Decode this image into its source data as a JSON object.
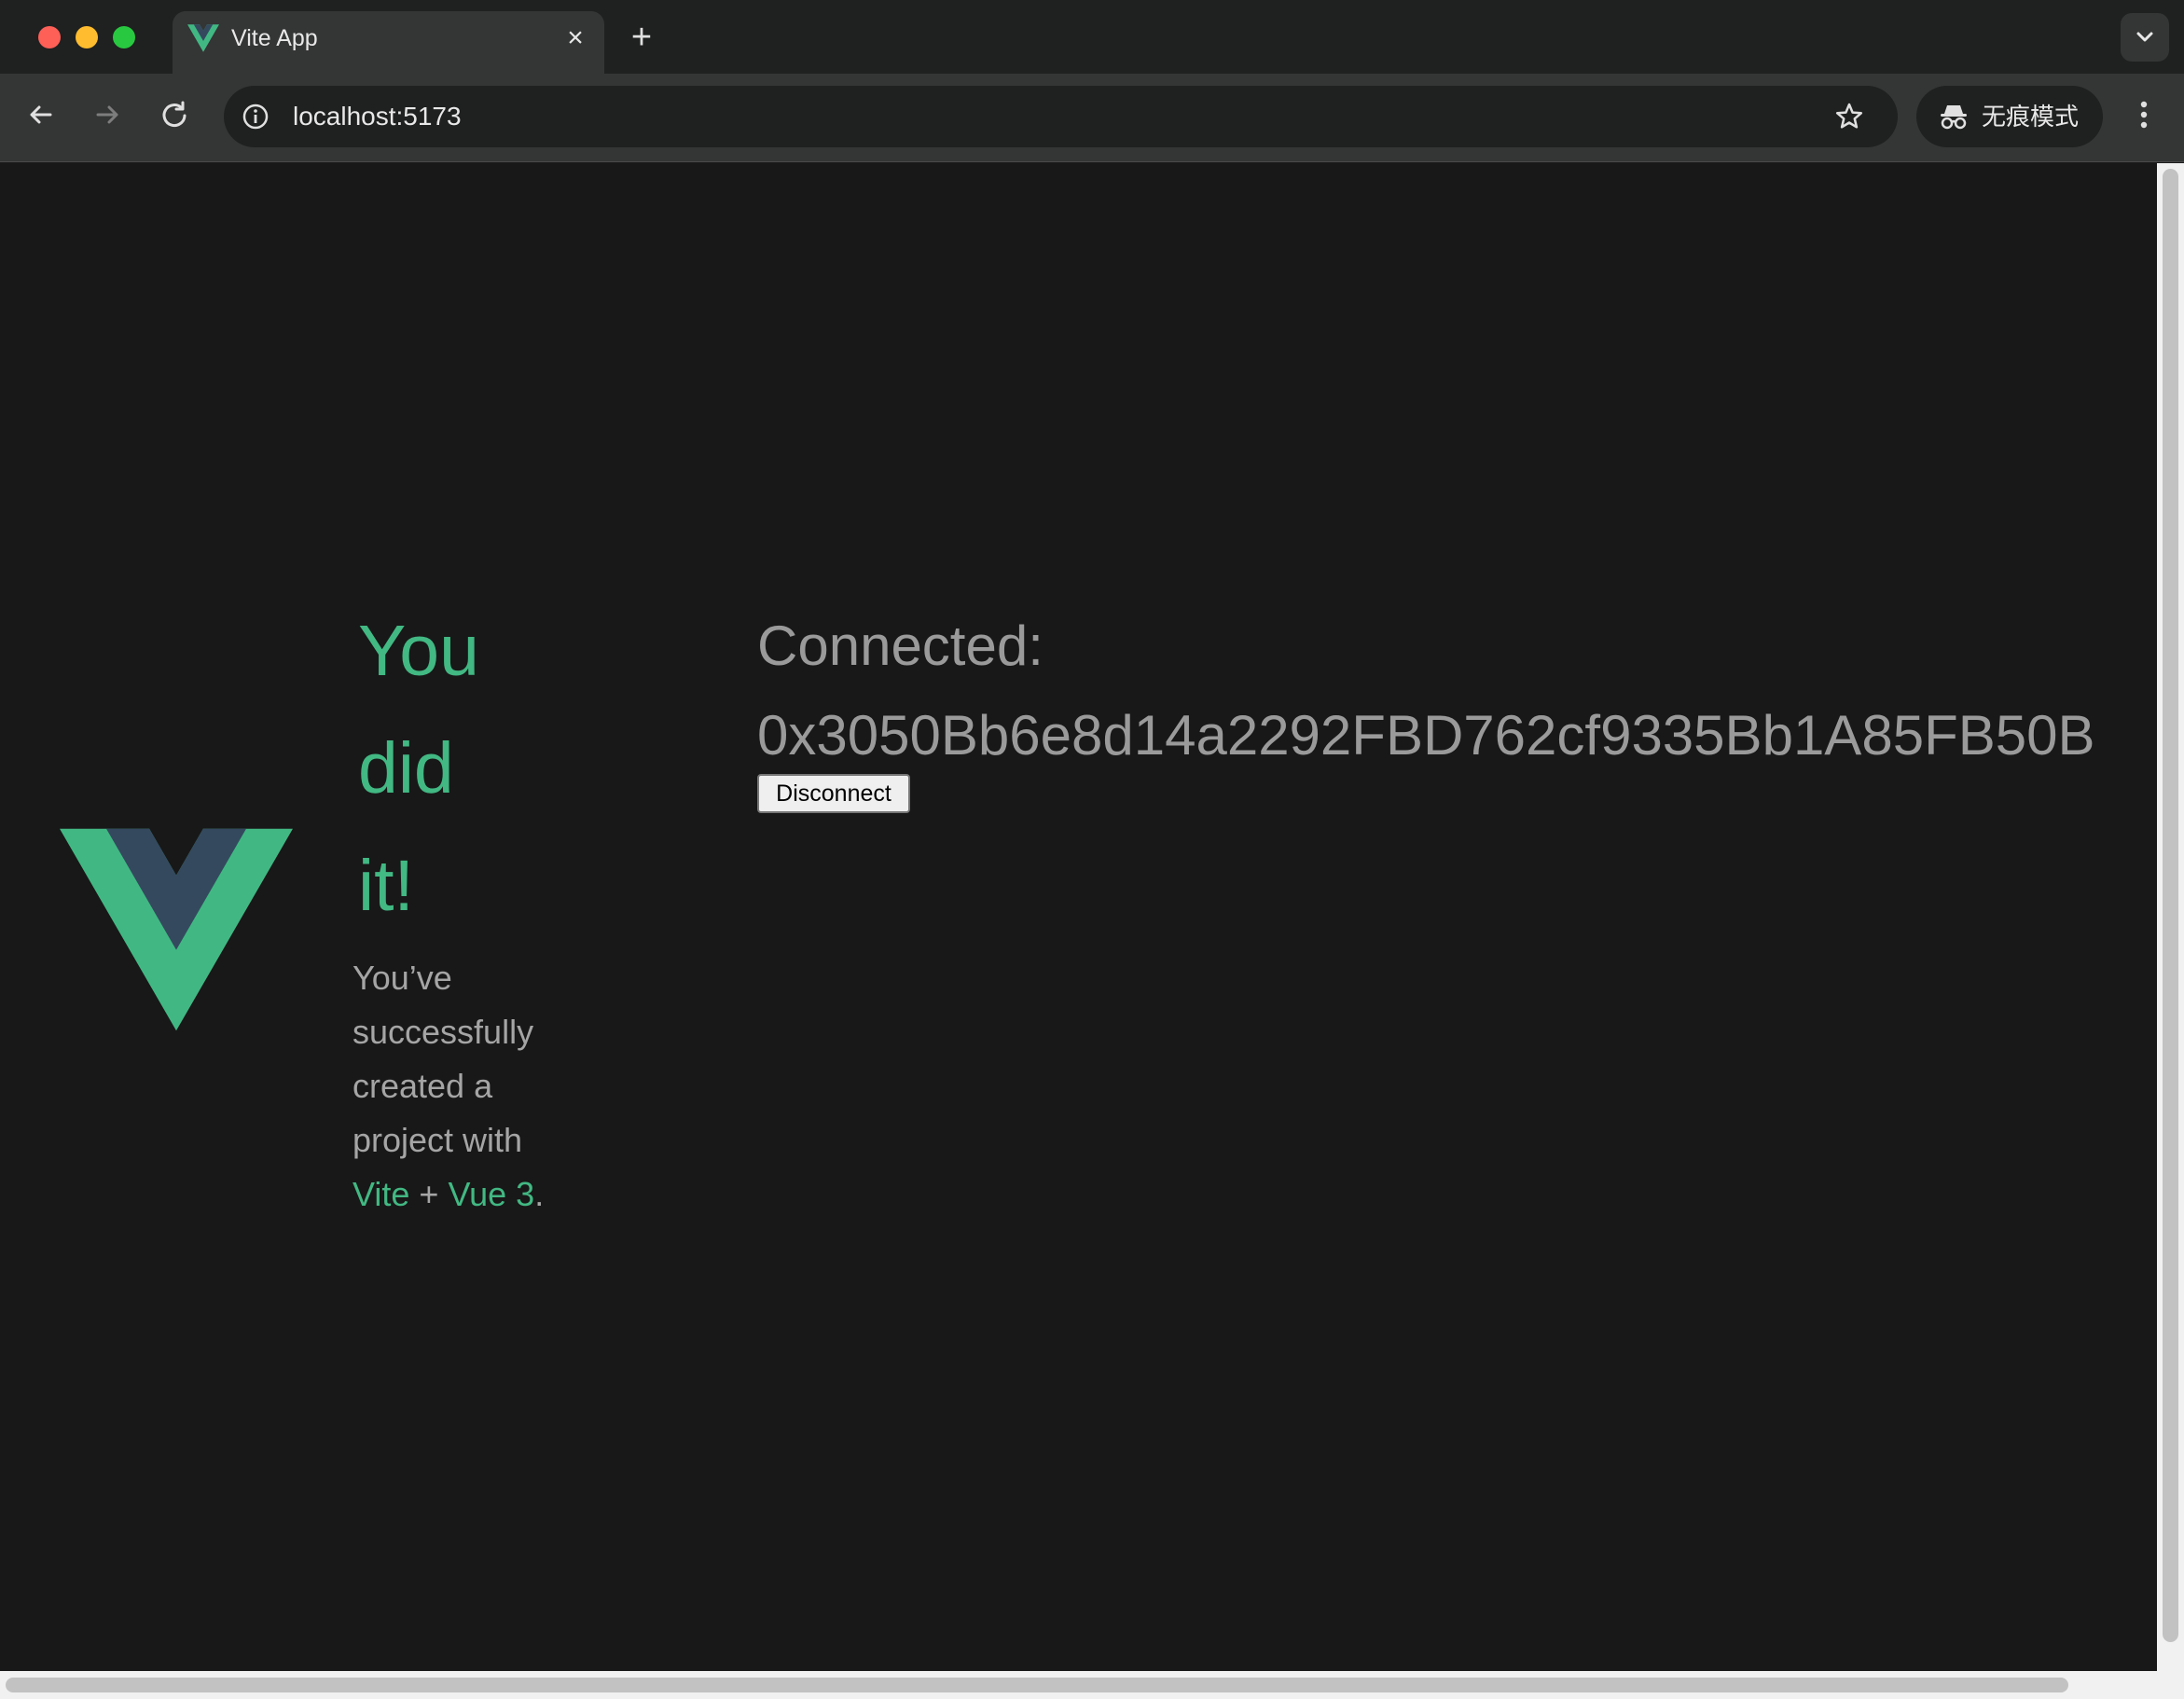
{
  "browser": {
    "tab": {
      "title": "Vite App",
      "close_glyph": "×",
      "favicon": "vue-logo-icon"
    },
    "new_tab_glyph": "+",
    "url": "localhost:5173",
    "incognito_label": "无痕模式"
  },
  "page": {
    "greeting_lines": [
      "You",
      "did",
      "it!"
    ],
    "subline": {
      "lead": "You’ve successfully created a project with",
      "link_vite": "Vite",
      "plus": "+",
      "link_vue": "Vue 3",
      "end": "."
    },
    "connected_label": "Connected:",
    "address": "0x3050Bb6e8d14a2292FBD762cf9335Bb1A85FB50B",
    "disconnect_label": "Disconnect"
  },
  "colors": {
    "accent": "#42b883",
    "vue_dark": "#35495e",
    "page_bg": "#181818",
    "muted_text": "#a5a5a5"
  }
}
